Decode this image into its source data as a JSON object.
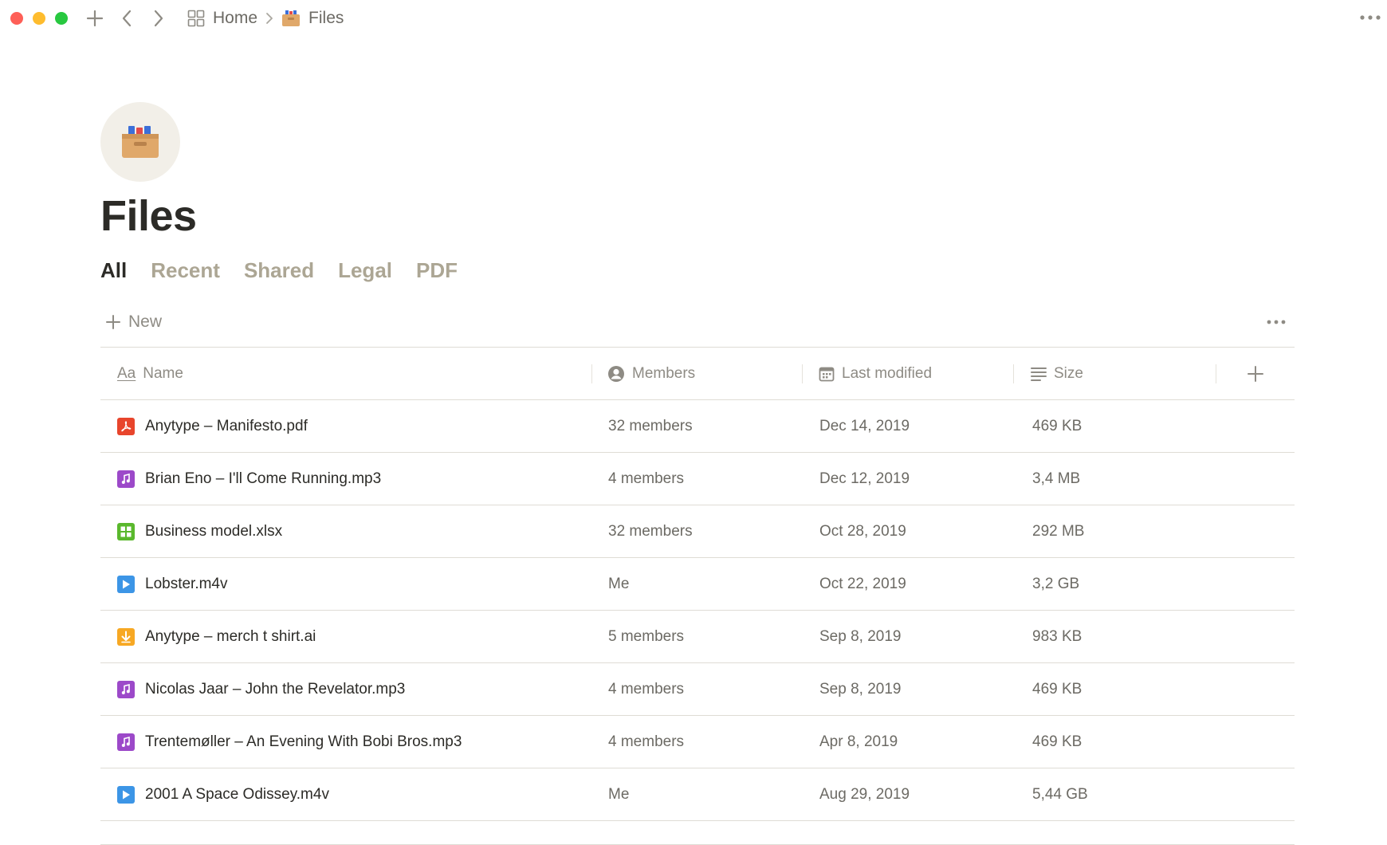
{
  "topbar": {
    "breadcrumb": [
      {
        "label": "Home",
        "icon": "grid-icon"
      },
      {
        "label": "Files",
        "icon": "file-box-icon"
      }
    ]
  },
  "page": {
    "icon": "file-box-icon",
    "title": "Files"
  },
  "tabs": [
    {
      "label": "All",
      "active": true
    },
    {
      "label": "Recent",
      "active": false
    },
    {
      "label": "Shared",
      "active": false
    },
    {
      "label": "Legal",
      "active": false
    },
    {
      "label": "PDF",
      "active": false
    }
  ],
  "toolbar": {
    "new_label": "New"
  },
  "table": {
    "columns": [
      {
        "label": "Name",
        "icon": "text-aa-icon"
      },
      {
        "label": "Members",
        "icon": "person-icon"
      },
      {
        "label": "Last modified",
        "icon": "calendar-icon"
      },
      {
        "label": "Size",
        "icon": "lines-icon"
      }
    ],
    "rows": [
      {
        "name": "Anytype – Manifesto.pdf",
        "type": "pdf",
        "members": "32 members",
        "modified": "Dec 14, 2019",
        "size": "469 KB"
      },
      {
        "name": "Brian Eno – I'll Come Running.mp3",
        "type": "audio",
        "members": "4 members",
        "modified": "Dec 12, 2019",
        "size": "3,4 MB"
      },
      {
        "name": "Business model.xlsx",
        "type": "sheet",
        "members": "32 members",
        "modified": "Oct 28, 2019",
        "size": "292 MB"
      },
      {
        "name": "Lobster.m4v",
        "type": "video",
        "members": "Me",
        "modified": "Oct 22, 2019",
        "size": "3,2 GB"
      },
      {
        "name": "Anytype – merch t shirt.ai",
        "type": "download",
        "members": "5 members",
        "modified": "Sep 8, 2019",
        "size": "983 KB"
      },
      {
        "name": "Nicolas Jaar – John the Revelator.mp3",
        "type": "audio",
        "members": "4 members",
        "modified": "Sep 8, 2019",
        "size": "469 KB"
      },
      {
        "name": "Trentemøller – An Evening With Bobi Bros.mp3",
        "type": "audio",
        "members": "4 members",
        "modified": "Apr 8, 2019",
        "size": "469 KB"
      },
      {
        "name": "2001 A Space Odissey.m4v",
        "type": "video",
        "members": "Me",
        "modified": "Aug 29, 2019",
        "size": "5,44 GB"
      }
    ]
  },
  "colors": {
    "pdf": "#e8452c",
    "audio": "#9c49c9",
    "sheet": "#5ab82d",
    "video": "#3c95e6",
    "download": "#f7a823",
    "muted_tab": "#aca694",
    "text": "#2c2b27"
  }
}
